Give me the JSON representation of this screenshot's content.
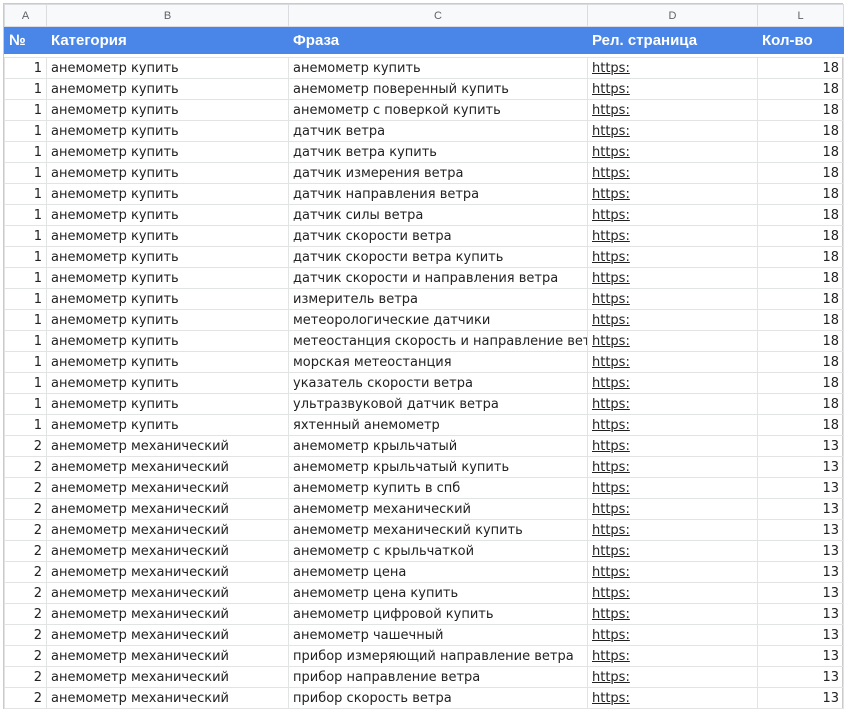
{
  "columns": [
    "A",
    "B",
    "C",
    "D",
    "L"
  ],
  "header": [
    "№",
    "Категория",
    "Фраза",
    "Рел. страница",
    "Кол-во"
  ],
  "rows": [
    [
      "1",
      "анемометр купить",
      "анемометр купить",
      "https:",
      "18"
    ],
    [
      "1",
      "анемометр купить",
      "анемометр поверенный купить",
      "https:",
      "18"
    ],
    [
      "1",
      "анемометр купить",
      "анемометр с поверкой купить",
      "https:",
      "18"
    ],
    [
      "1",
      "анемометр купить",
      "датчик ветра",
      "https:",
      "18"
    ],
    [
      "1",
      "анемометр купить",
      "датчик ветра купить",
      "https:",
      "18"
    ],
    [
      "1",
      "анемометр купить",
      "датчик измерения ветра",
      "https:",
      "18"
    ],
    [
      "1",
      "анемометр купить",
      "датчик направления ветра",
      "https:",
      "18"
    ],
    [
      "1",
      "анемометр купить",
      "датчик силы ветра",
      "https:",
      "18"
    ],
    [
      "1",
      "анемометр купить",
      "датчик скорости ветра",
      "https:",
      "18"
    ],
    [
      "1",
      "анемометр купить",
      "датчик скорости ветра купить",
      "https:",
      "18"
    ],
    [
      "1",
      "анемометр купить",
      "датчик скорости и направления ветра",
      "https:",
      "18"
    ],
    [
      "1",
      "анемометр купить",
      "измеритель ветра",
      "https:",
      "18"
    ],
    [
      "1",
      "анемометр купить",
      "метеорологические датчики",
      "https:",
      "18"
    ],
    [
      "1",
      "анемометр купить",
      "метеостанция скорость и направление ветра",
      "https:",
      "18"
    ],
    [
      "1",
      "анемометр купить",
      "морская метеостанция",
      "https:",
      "18"
    ],
    [
      "1",
      "анемометр купить",
      "указатель скорости ветра",
      "https:",
      "18"
    ],
    [
      "1",
      "анемометр купить",
      "ультразвуковой датчик ветра",
      "https:",
      "18"
    ],
    [
      "1",
      "анемометр купить",
      "яхтенный анемометр",
      "https:",
      "18"
    ],
    [
      "2",
      "анемометр механический",
      "анемометр крыльчатый",
      "https:",
      "13"
    ],
    [
      "2",
      "анемометр механический",
      "анемометр крыльчатый купить",
      "https:",
      "13"
    ],
    [
      "2",
      "анемометр механический",
      "анемометр купить в спб",
      "https:",
      "13"
    ],
    [
      "2",
      "анемометр механический",
      "анемометр механический",
      "https:",
      "13"
    ],
    [
      "2",
      "анемометр механический",
      "анемометр механический купить",
      "https:",
      "13"
    ],
    [
      "2",
      "анемометр механический",
      "анемометр с крыльчаткой",
      "https:",
      "13"
    ],
    [
      "2",
      "анемометр механический",
      "анемометр цена",
      "https:",
      "13"
    ],
    [
      "2",
      "анемометр механический",
      "анемометр цена купить",
      "https:",
      "13"
    ],
    [
      "2",
      "анемометр механический",
      "анемометр цифровой купить",
      "https:",
      "13"
    ],
    [
      "2",
      "анемометр механический",
      "анемометр чашечный",
      "https:",
      "13"
    ],
    [
      "2",
      "анемометр механический",
      "прибор измеряющий направление ветра",
      "https:",
      "13"
    ],
    [
      "2",
      "анемометр механический",
      "прибор направление ветра",
      "https:",
      "13"
    ],
    [
      "2",
      "анемометр механический",
      "прибор скорость ветра",
      "https:",
      "13"
    ]
  ]
}
